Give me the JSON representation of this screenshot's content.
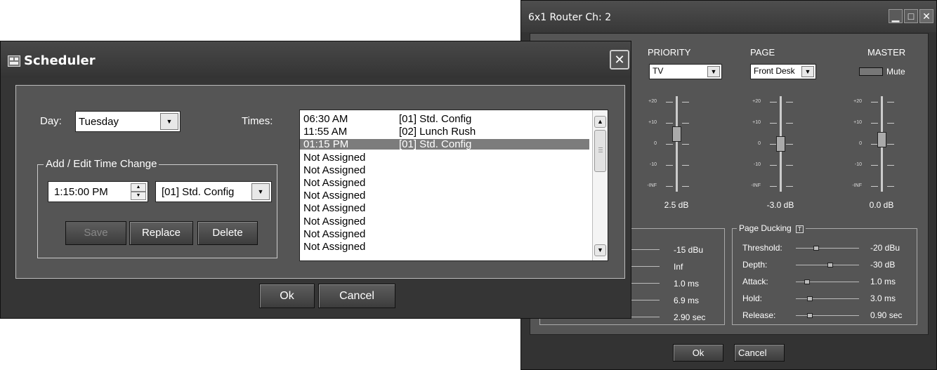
{
  "router": {
    "title": "6x1 Router   Ch: 2",
    "window_buttons": {
      "minimize": "▁",
      "maximize": "□",
      "close": "✕"
    },
    "columns": {
      "priority": {
        "header": "PRIORITY",
        "value": "TV",
        "level": "2.5 dB",
        "fader_position": 0.62
      },
      "page": {
        "header": "PAGE",
        "value": "Front Desk",
        "level": "-3.0 dB",
        "fader_position": 0.5
      },
      "master": {
        "header": "MASTER",
        "mute_label": "Mute",
        "level": "0.0 dB",
        "fader_position": 0.55
      }
    },
    "scale": [
      "+20",
      "+10",
      "0",
      "-10",
      "-INF"
    ],
    "left_values": [
      "-15 dBu",
      "Inf",
      "1.0 ms",
      "6.9 ms",
      "2.90 sec"
    ],
    "page_ducking": {
      "title": "Page Ducking",
      "badge": "T",
      "params": [
        {
          "label": "Threshold:",
          "value": "-20 dBu",
          "position": 0.3
        },
        {
          "label": "Depth:",
          "value": "-30 dB",
          "position": 0.55
        },
        {
          "label": "Attack:",
          "value": "1.0 ms",
          "position": 0.15
        },
        {
          "label": "Hold:",
          "value": "3.0 ms",
          "position": 0.2
        },
        {
          "label": "Release:",
          "value": "0.90 sec",
          "position": 0.2
        }
      ]
    },
    "ok_label": "Ok",
    "cancel_label": "Cancel"
  },
  "scheduler": {
    "title": "Scheduler",
    "close_glyph": "✕",
    "day_label": "Day:",
    "day_value": "Tuesday",
    "times_label": "Times:",
    "group_title": "Add / Edit Time Change",
    "time_value": "1:15:00 PM",
    "config_value": "[01] Std. Config",
    "save_label": "Save",
    "replace_label": "Replace",
    "delete_label": "Delete",
    "times": [
      {
        "time": "06:30 AM",
        "config": "[01] Std. Config",
        "selected": false
      },
      {
        "time": "11:55 AM",
        "config": "[02] Lunch Rush",
        "selected": false
      },
      {
        "time": "01:15 PM",
        "config": "[01] Std. Config",
        "selected": true
      },
      {
        "time": "Not Assigned",
        "config": "",
        "selected": false
      },
      {
        "time": "Not Assigned",
        "config": "",
        "selected": false
      },
      {
        "time": "Not Assigned",
        "config": "",
        "selected": false
      },
      {
        "time": "Not Assigned",
        "config": "",
        "selected": false
      },
      {
        "time": "Not Assigned",
        "config": "",
        "selected": false
      },
      {
        "time": "Not Assigned",
        "config": "",
        "selected": false
      },
      {
        "time": "Not Assigned",
        "config": "",
        "selected": false
      },
      {
        "time": "Not Assigned",
        "config": "",
        "selected": false
      }
    ],
    "ok_label": "Ok",
    "cancel_label": "Cancel"
  }
}
